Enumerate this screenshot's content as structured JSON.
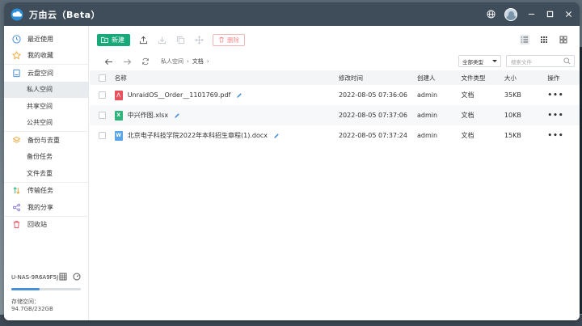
{
  "app": {
    "title": "万由云（Beta）"
  },
  "sidebar": {
    "items": [
      {
        "label": "最近使用",
        "icon": "clock-icon"
      },
      {
        "label": "我的收藏",
        "icon": "star-icon"
      },
      {
        "label": "云盘空间",
        "icon": "disk-icon"
      },
      {
        "label": "私人空间",
        "sub": true,
        "active": true
      },
      {
        "label": "共享空间",
        "sub": true
      },
      {
        "label": "公共空间",
        "sub": true
      },
      {
        "label": "备份与去重",
        "icon": "layers-icon"
      },
      {
        "label": "备份任务",
        "sub": true
      },
      {
        "label": "文件去重",
        "sub": true
      },
      {
        "label": "传输任务",
        "icon": "transfer-icon"
      },
      {
        "label": "我的分享",
        "icon": "share-icon"
      },
      {
        "label": "回收站",
        "icon": "trash-icon"
      }
    ],
    "device": "U-NAS-9R6A9F5J",
    "storage": {
      "label": "存储空间：94.7GB/232GB",
      "used_fraction": 0.41
    }
  },
  "toolbar": {
    "new_label": "新建",
    "delete_label": "删除"
  },
  "nav": {
    "breadcrumb": [
      "私人空间",
      "文档"
    ],
    "filter_value": "全部类型",
    "search_placeholder": "搜索文件"
  },
  "table": {
    "headers": {
      "name": "名称",
      "time": "修改时间",
      "owner": "创建人",
      "type": "文件类型",
      "size": "大小",
      "op": "操作"
    },
    "rows": [
      {
        "name": "UnraidOS__Order__1101769.pdf",
        "time": "2022-08-05 07:36:06",
        "owner": "admin",
        "type": "文档",
        "size": "35KB",
        "icon": "pdf",
        "color": "#e8505b"
      },
      {
        "name": "中兴作图.xlsx",
        "time": "2022-08-05 07:37:06",
        "owner": "admin",
        "type": "文档",
        "size": "10KB",
        "icon": "xlsx",
        "color": "#2fb57c"
      },
      {
        "name": "北京电子科技学院2022年本科招生章程(1).docx",
        "time": "2022-08-05 07:37:24",
        "owner": "admin",
        "type": "文档",
        "size": "15KB",
        "icon": "docx",
        "color": "#5aa6e8"
      }
    ],
    "more": "•••"
  },
  "colors": {
    "titlebar": "#3f4d5b",
    "accent": "#17a979",
    "active_bg": "#e8ecef"
  }
}
